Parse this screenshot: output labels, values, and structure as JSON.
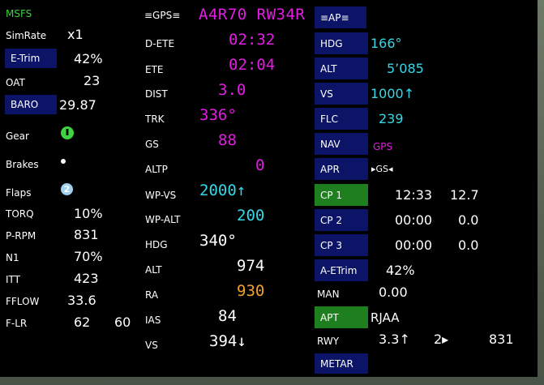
{
  "left": {
    "title": "MSFS",
    "rows": [
      {
        "label": "SimRate",
        "value": "x1"
      },
      {
        "label": "E-Trim",
        "value": "42%"
      },
      {
        "label": "OAT",
        "value": "23"
      },
      {
        "label": "BARO",
        "value": "29.87"
      },
      {
        "label": "Gear",
        "value": ""
      },
      {
        "label": "Brakes",
        "value": ""
      },
      {
        "label": "Flaps",
        "value": "2"
      },
      {
        "label": "TORQ",
        "value": "10%"
      },
      {
        "label": "P-RPM",
        "value": "831"
      },
      {
        "label": "N1",
        "value": "70%"
      },
      {
        "label": "ITT",
        "value": "423"
      },
      {
        "label": "FFLOW",
        "value": "33.6"
      },
      {
        "label": "F-LR",
        "value": "62",
        "value2": "60"
      }
    ]
  },
  "gps": {
    "header": "≡GPS≡",
    "route": "A4R70 RW34R",
    "rows": [
      {
        "label": "D-ETE",
        "value": "02:32"
      },
      {
        "label": "ETE",
        "value": "02:04"
      },
      {
        "label": "DIST",
        "value": "3.0"
      },
      {
        "label": "TRK",
        "value": "336°"
      },
      {
        "label": "GS",
        "value": "88"
      },
      {
        "label": "ALTP",
        "value": "0"
      },
      {
        "label": "WP-VS",
        "value": "2000↑"
      },
      {
        "label": "WP-ALT",
        "value": "200"
      },
      {
        "label": "HDG",
        "value": "340°"
      },
      {
        "label": "ALT",
        "value": "974"
      },
      {
        "label": "RA",
        "value": "930"
      },
      {
        "label": "IAS",
        "value": "84"
      },
      {
        "label": "VS",
        "value": "394↓"
      }
    ]
  },
  "ap": {
    "header": "≡AP≡",
    "rows": [
      {
        "label": "HDG",
        "value": "166°"
      },
      {
        "label": "ALT",
        "value": "5’085"
      },
      {
        "label": "VS",
        "value": "1000↑"
      },
      {
        "label": "FLC",
        "value": "239"
      },
      {
        "label": "NAV",
        "value": "GPS"
      },
      {
        "label": "APR",
        "value": "▸GS◂"
      },
      {
        "label": "CP 1",
        "value": "12:33",
        "value2": "12.7"
      },
      {
        "label": "CP 2",
        "value": "00:00",
        "value2": "0.0"
      },
      {
        "label": "CP 3",
        "value": "00:00",
        "value2": "0.0"
      },
      {
        "label": "A-ETrim",
        "value": "42%"
      },
      {
        "label": "MAN",
        "value": "0.00"
      },
      {
        "label": "APT",
        "value": "RJAA"
      },
      {
        "label": "RWY",
        "value": "3.3↑",
        "value2": "2▸",
        "value3": "831"
      },
      {
        "label": "METAR",
        "value": ""
      }
    ]
  },
  "colors": {
    "button_blue": "#0b1466",
    "button_green": "#1d7f1d",
    "magenta": "#e21ce2",
    "cyan": "#35d8e8",
    "orange": "#f3a02c",
    "gear_green": "#3fd43f",
    "flaps_blue": "#9fd0f0"
  },
  "icons": {
    "gear": "gear-down-icon",
    "brakes": "brakes-dot-icon",
    "flaps": "flaps-position-icon"
  }
}
